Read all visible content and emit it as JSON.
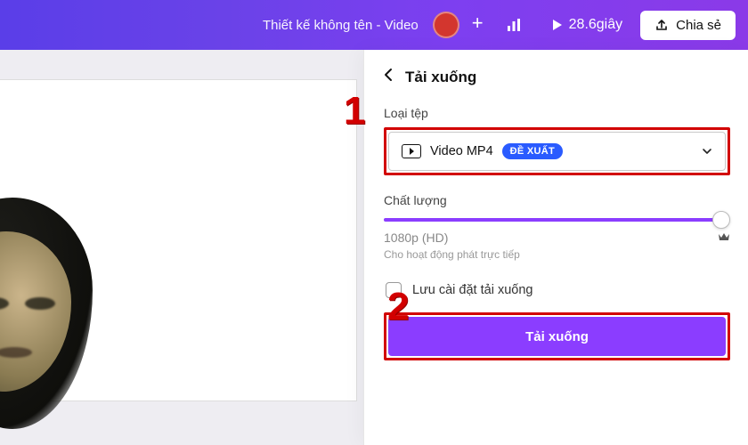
{
  "header": {
    "title": "Thiết kế không tên - Video",
    "duration_label": "28.6giây",
    "share_label": "Chia sẻ"
  },
  "panel": {
    "title": "Tải xuống",
    "file_type_label": "Loại tệp",
    "file_type_value": "Video MP4",
    "file_type_badge": "ĐỀ XUẤT",
    "quality_label": "Chất lượng",
    "quality_value": "1080p (HD)",
    "quality_hint": "Cho hoạt động phát trực tiếp",
    "save_settings_label": "Lưu cài đặt tải xuống",
    "download_button": "Tải xuống"
  },
  "annotations": {
    "one": "1",
    "two": "2"
  }
}
